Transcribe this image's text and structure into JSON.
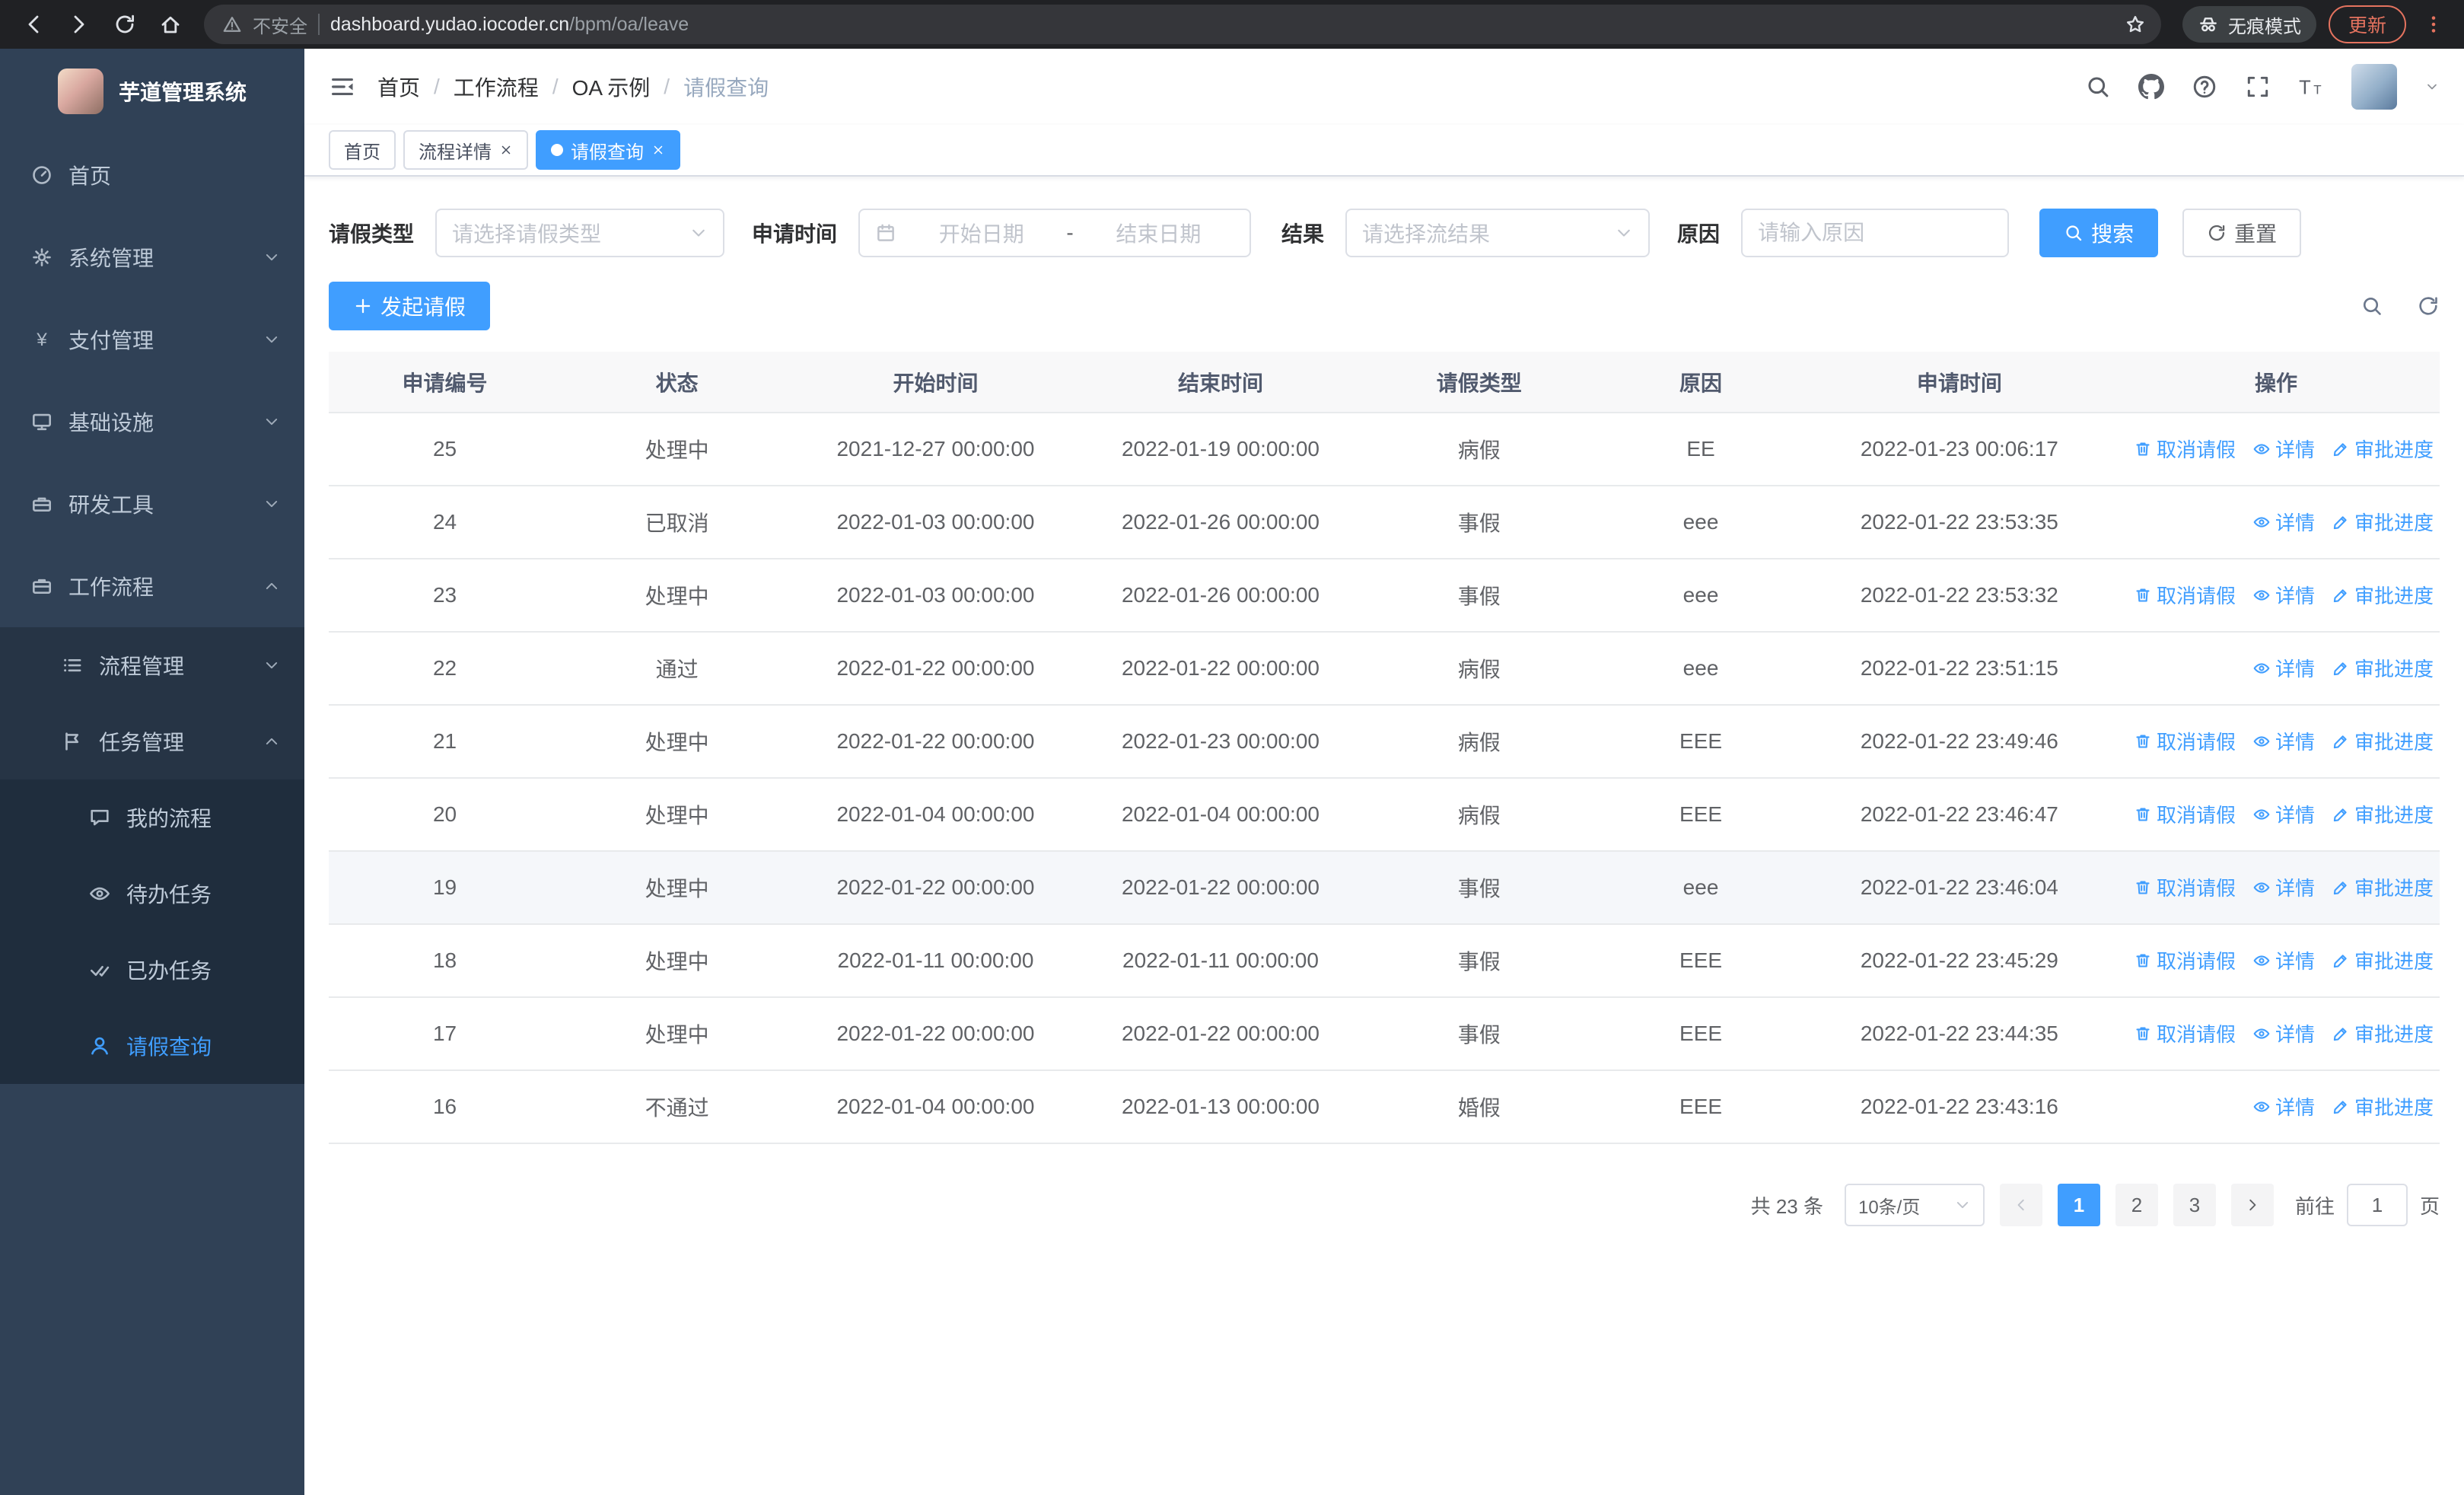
{
  "colors": {
    "primary": "#409eff",
    "sidebar_bg": "#304156",
    "sidebar_sub_bg": "#1f2d3d"
  },
  "browser": {
    "security_warning": "不安全",
    "url_domain": "dashboard.yudao.iocoder.cn",
    "url_path": "/bpm/oa/leave",
    "incognito_label": "无痕模式",
    "update_label": "更新"
  },
  "sidebar": {
    "logo_title": "芋道管理系统",
    "items": [
      {
        "label": "首页",
        "icon": "dashboard",
        "level": 1,
        "chevron": null,
        "active": false
      },
      {
        "label": "系统管理",
        "icon": "gear",
        "level": 1,
        "chevron": "down",
        "active": false
      },
      {
        "label": "支付管理",
        "icon": "yen",
        "level": 1,
        "chevron": "down",
        "active": false
      },
      {
        "label": "基础设施",
        "icon": "monitor",
        "level": 1,
        "chevron": "down",
        "active": false
      },
      {
        "label": "研发工具",
        "icon": "toolbox",
        "level": 1,
        "chevron": "down",
        "active": false
      },
      {
        "label": "工作流程",
        "icon": "briefcase",
        "level": 1,
        "chevron": "up",
        "active": false
      },
      {
        "label": "流程管理",
        "icon": "list",
        "level": 2,
        "chevron": "down",
        "active": false
      },
      {
        "label": "任务管理",
        "icon": "flag",
        "level": 2,
        "chevron": "up",
        "active": false
      },
      {
        "label": "我的流程",
        "icon": "chat",
        "level": 3,
        "chevron": null,
        "active": false
      },
      {
        "label": "待办任务",
        "icon": "eye",
        "level": 3,
        "chevron": null,
        "active": false
      },
      {
        "label": "已办任务",
        "icon": "done",
        "level": 3,
        "chevron": null,
        "active": false
      },
      {
        "label": "请假查询",
        "icon": "user",
        "level": 3,
        "chevron": null,
        "active": true
      }
    ]
  },
  "breadcrumb": {
    "separator": "/",
    "items": [
      "首页",
      "工作流程",
      "OA 示例",
      "请假查询"
    ]
  },
  "tabs": [
    {
      "label": "首页",
      "closable": false,
      "active": false
    },
    {
      "label": "流程详情",
      "closable": true,
      "active": false
    },
    {
      "label": "请假查询",
      "closable": true,
      "active": true
    }
  ],
  "filters": {
    "type_label": "请假类型",
    "type_placeholder": "请选择请假类型",
    "time_label": "申请时间",
    "start_placeholder": "开始日期",
    "range_separator": "-",
    "end_placeholder": "结束日期",
    "result_label": "结果",
    "result_placeholder": "请选择流结果",
    "reason_label": "原因",
    "reason_placeholder": "请输入原因",
    "search_label": "搜索",
    "reset_label": "重置"
  },
  "toolbar": {
    "create_label": "发起请假"
  },
  "table": {
    "columns": [
      "申请编号",
      "状态",
      "开始时间",
      "结束时间",
      "请假类型",
      "原因",
      "申请时间",
      "操作"
    ],
    "action_labels": {
      "cancel": "取消请假",
      "detail": "详情",
      "progress": "审批进度"
    },
    "rows": [
      {
        "id": "25",
        "status": "处理中",
        "start": "2021-12-27 00:00:00",
        "end": "2022-01-19 00:00:00",
        "type": "病假",
        "reason": "EE",
        "apply_time": "2022-01-23 00:06:17",
        "actions": [
          "cancel",
          "detail",
          "progress"
        ],
        "highlight": false
      },
      {
        "id": "24",
        "status": "已取消",
        "start": "2022-01-03 00:00:00",
        "end": "2022-01-26 00:00:00",
        "type": "事假",
        "reason": "eee",
        "apply_time": "2022-01-22 23:53:35",
        "actions": [
          "detail",
          "progress"
        ],
        "highlight": false
      },
      {
        "id": "23",
        "status": "处理中",
        "start": "2022-01-03 00:00:00",
        "end": "2022-01-26 00:00:00",
        "type": "事假",
        "reason": "eee",
        "apply_time": "2022-01-22 23:53:32",
        "actions": [
          "cancel",
          "detail",
          "progress"
        ],
        "highlight": false
      },
      {
        "id": "22",
        "status": "通过",
        "start": "2022-01-22 00:00:00",
        "end": "2022-01-22 00:00:00",
        "type": "病假",
        "reason": "eee",
        "apply_time": "2022-01-22 23:51:15",
        "actions": [
          "detail",
          "progress"
        ],
        "highlight": false
      },
      {
        "id": "21",
        "status": "处理中",
        "start": "2022-01-22 00:00:00",
        "end": "2022-01-23 00:00:00",
        "type": "病假",
        "reason": "EEE",
        "apply_time": "2022-01-22 23:49:46",
        "actions": [
          "cancel",
          "detail",
          "progress"
        ],
        "highlight": false
      },
      {
        "id": "20",
        "status": "处理中",
        "start": "2022-01-04 00:00:00",
        "end": "2022-01-04 00:00:00",
        "type": "病假",
        "reason": "EEE",
        "apply_time": "2022-01-22 23:46:47",
        "actions": [
          "cancel",
          "detail",
          "progress"
        ],
        "highlight": false
      },
      {
        "id": "19",
        "status": "处理中",
        "start": "2022-01-22 00:00:00",
        "end": "2022-01-22 00:00:00",
        "type": "事假",
        "reason": "eee",
        "apply_time": "2022-01-22 23:46:04",
        "actions": [
          "cancel",
          "detail",
          "progress"
        ],
        "highlight": true
      },
      {
        "id": "18",
        "status": "处理中",
        "start": "2022-01-11 00:00:00",
        "end": "2022-01-11 00:00:00",
        "type": "事假",
        "reason": "EEE",
        "apply_time": "2022-01-22 23:45:29",
        "actions": [
          "cancel",
          "detail",
          "progress"
        ],
        "highlight": false
      },
      {
        "id": "17",
        "status": "处理中",
        "start": "2022-01-22 00:00:00",
        "end": "2022-01-22 00:00:00",
        "type": "事假",
        "reason": "EEE",
        "apply_time": "2022-01-22 23:44:35",
        "actions": [
          "cancel",
          "detail",
          "progress"
        ],
        "highlight": false
      },
      {
        "id": "16",
        "status": "不通过",
        "start": "2022-01-04 00:00:00",
        "end": "2022-01-13 00:00:00",
        "type": "婚假",
        "reason": "EEE",
        "apply_time": "2022-01-22 23:43:16",
        "actions": [
          "detail",
          "progress"
        ],
        "highlight": false
      }
    ]
  },
  "pagination": {
    "total_label": "共 23 条",
    "page_size_label": "10条/页",
    "pages": [
      "1",
      "2",
      "3"
    ],
    "active_page": "1",
    "goto_label": "前往",
    "goto_value": "1",
    "page_unit": "页"
  }
}
